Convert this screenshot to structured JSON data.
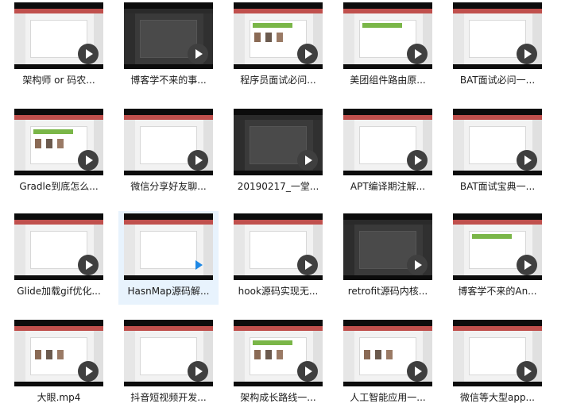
{
  "files": [
    {
      "name": "架构师 or 码农..."
    },
    {
      "name": "博客学不来的事..."
    },
    {
      "name": "程序员面试必问..."
    },
    {
      "name": "美团组件路由原..."
    },
    {
      "name": "BAT面试必问一..."
    },
    {
      "name": "Gradle到底怎么..."
    },
    {
      "name": "微信分享好友聊..."
    },
    {
      "name": "20190217_一堂..."
    },
    {
      "name": "APT编译期注解..."
    },
    {
      "name": "BAT面试宝典一..."
    },
    {
      "name": "Glide加载gif优化..."
    },
    {
      "name": "HasnMap源码解...",
      "selected": true
    },
    {
      "name": "hook源码实现无..."
    },
    {
      "name": "retrofit源码内核..."
    },
    {
      "name": "博客学不来的An..."
    },
    {
      "name": "大眼.mp4"
    },
    {
      "name": "抖音短视频开发..."
    },
    {
      "name": "架构成长路线一..."
    },
    {
      "name": "人工智能应用一..."
    },
    {
      "name": "微信等大型app..."
    }
  ],
  "colors": {
    "selection": "#e8f3fd",
    "play_selected": "#1e88e5"
  }
}
